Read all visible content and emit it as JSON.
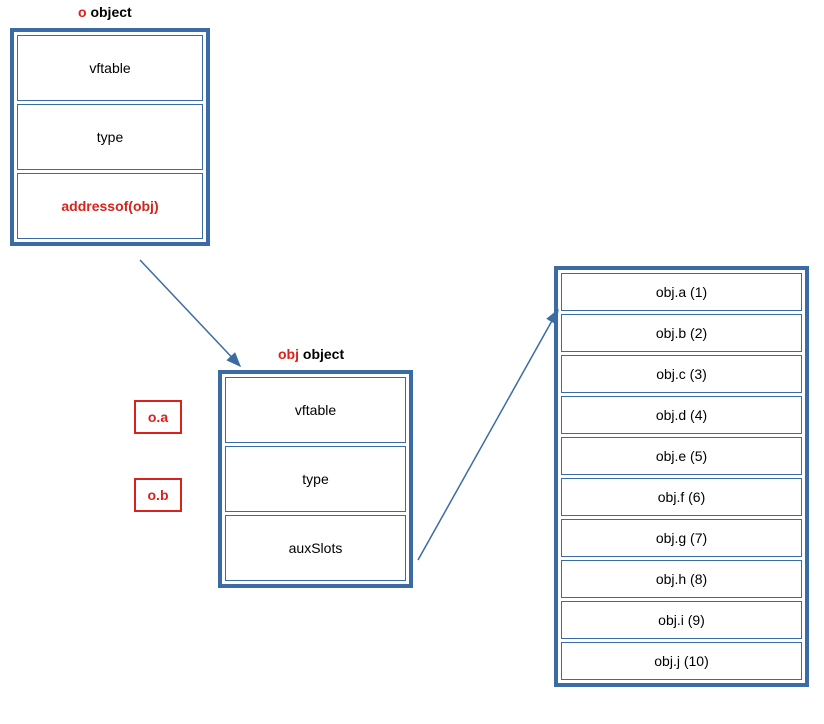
{
  "labels": {
    "oObject": {
      "red": "o",
      "rest": " object"
    },
    "objObject": {
      "red": "obj",
      "rest": " object"
    }
  },
  "boxes": {
    "o": {
      "cells": [
        {
          "text": "vftable",
          "red": false
        },
        {
          "text": "type",
          "red": false
        },
        {
          "text": "addressof(obj)",
          "red": true
        }
      ]
    },
    "obj": {
      "cells": [
        {
          "text": "vftable",
          "red": false
        },
        {
          "text": "type",
          "red": false
        },
        {
          "text": "auxSlots",
          "red": false
        }
      ]
    },
    "slots": {
      "cells": [
        {
          "text": "obj.a (1)"
        },
        {
          "text": "obj.b (2)"
        },
        {
          "text": "obj.c (3)"
        },
        {
          "text": "obj.d (4)"
        },
        {
          "text": "obj.e (5)"
        },
        {
          "text": "obj.f (6)"
        },
        {
          "text": "obj.g (7)"
        },
        {
          "text": "obj.h (8)"
        },
        {
          "text": "obj.i (9)"
        },
        {
          "text": "obj.j (10)"
        }
      ]
    }
  },
  "sideBoxes": {
    "oa": "o.a",
    "ob": "o.b"
  }
}
